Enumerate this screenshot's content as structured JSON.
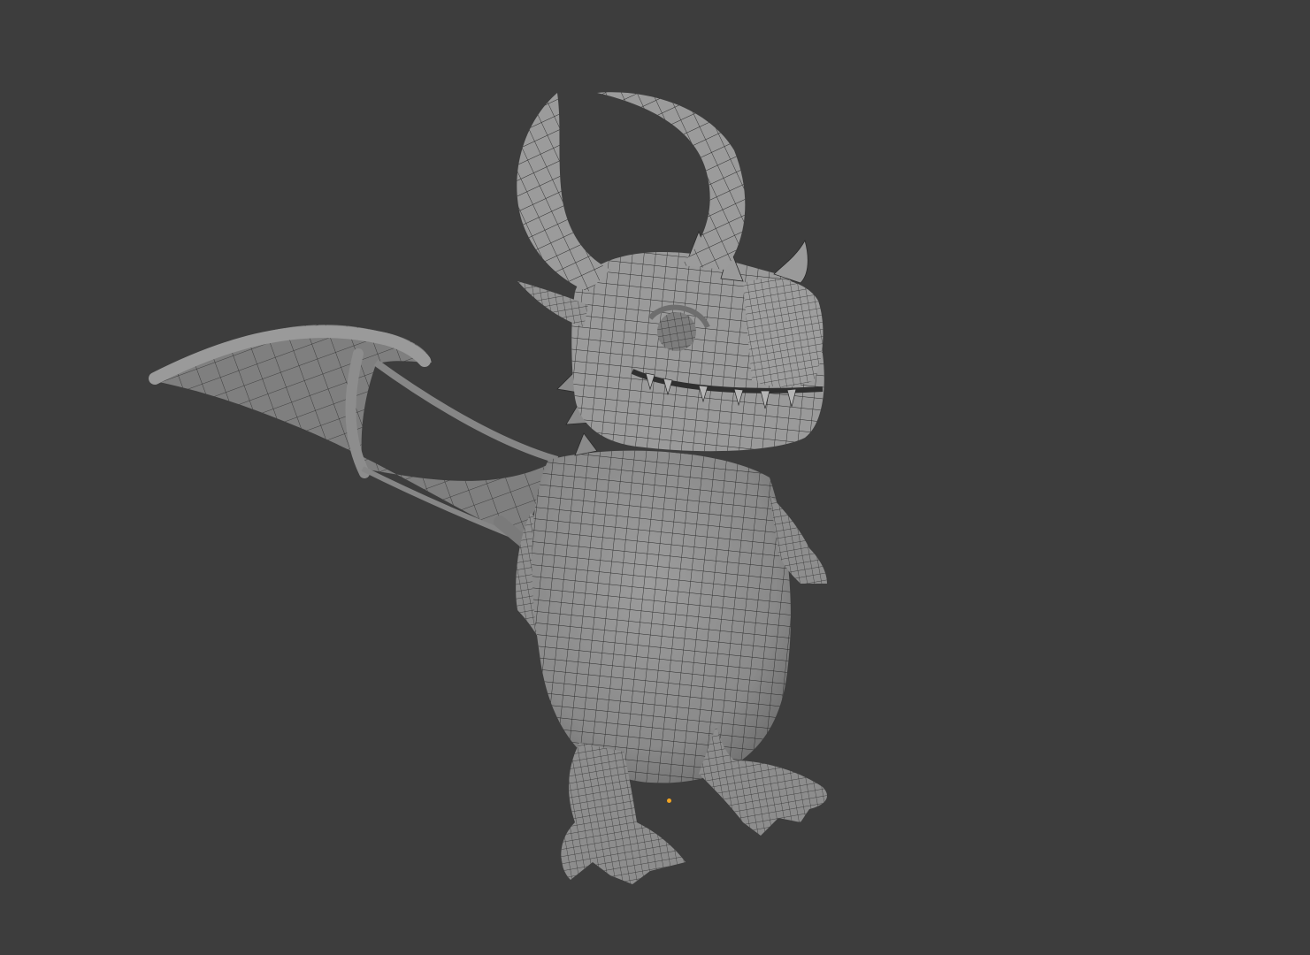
{
  "viewport": {
    "background_color": "#3d3d3d",
    "mesh_color": "#8f8f8f",
    "mesh_shadow_color": "#5e5e5e",
    "wire_color": "#2b2b2b",
    "origin_color": "#f2a422"
  },
  "object": {
    "icon": "dragon-mesh-icon"
  }
}
